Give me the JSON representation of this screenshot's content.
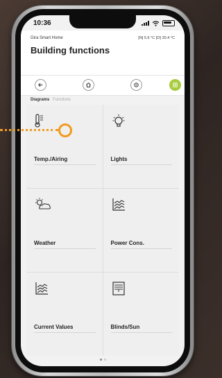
{
  "status_bar": {
    "time": "10:36"
  },
  "header": {
    "app_name": "Gira Smart Home",
    "temperatures": "[N] 5.6 °C [O] 20.4 °C",
    "title": "Building functions"
  },
  "nav": {
    "buttons": [
      {
        "icon": "back-arrow-icon"
      },
      {
        "icon": "home-icon"
      },
      {
        "icon": "settings-icon"
      },
      {
        "icon": "grid-view-icon",
        "active": true
      }
    ],
    "accent": "#a8cc3f"
  },
  "tabs": {
    "active": "Diagrams",
    "inactive": "Functions"
  },
  "tiles": [
    {
      "label": "Temp./Airing",
      "icon": "thermometer-icon"
    },
    {
      "label": "Lights",
      "icon": "lightbulb-icon"
    },
    {
      "label": "Weather",
      "icon": "weather-icon"
    },
    {
      "label": "Power Cons.",
      "icon": "chart-icon"
    },
    {
      "label": "Current Values",
      "icon": "chart-icon"
    },
    {
      "label": "Blinds/Sun",
      "icon": "blinds-icon"
    }
  ],
  "callout_color": "#f29a1f"
}
